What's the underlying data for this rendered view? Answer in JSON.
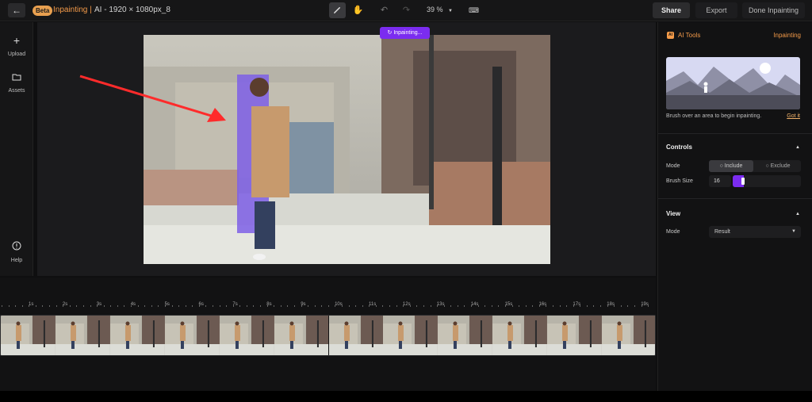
{
  "topbar": {
    "back_icon": "arrow-left-icon",
    "beta_label": "Beta",
    "mode_title": "Inpainting |",
    "file_title": "AI - 1920 × 1080px_8",
    "zoom": "39 %",
    "buttons": {
      "share": "Share",
      "export": "Export",
      "done": "Done Inpainting"
    }
  },
  "leftrail": {
    "items": [
      {
        "icon": "plus-icon",
        "label": "Upload"
      },
      {
        "icon": "folder-icon",
        "label": "Assets"
      },
      {
        "icon": "help-icon",
        "label": "Help"
      }
    ]
  },
  "canvas": {
    "status_chip": "Inpainting..."
  },
  "panel": {
    "badge": "AI",
    "title": "AI Tools",
    "mode": "Inpainting",
    "hint": "Brush over an area to begin inpainting.",
    "got_it": "Got it",
    "controls": {
      "title": "Controls",
      "mode_label": "Mode",
      "include": "Include",
      "exclude": "Exclude",
      "brush_label": "Brush Size",
      "brush_value": "16"
    },
    "view": {
      "title": "View",
      "mode_label": "Mode",
      "mode_value": "Result"
    }
  },
  "timeline": {
    "ticks": [
      "1s",
      "2s",
      "3s",
      "4s",
      "5s",
      "6s",
      "7s",
      "8s",
      "9s",
      "10s",
      "11s",
      "12s",
      "13s",
      "14s",
      "15s",
      "16s",
      "17s",
      "18s",
      "19s"
    ],
    "frame_count": 12
  },
  "colors": {
    "accent": "#7b2cf0",
    "brand": "#f39a49"
  }
}
